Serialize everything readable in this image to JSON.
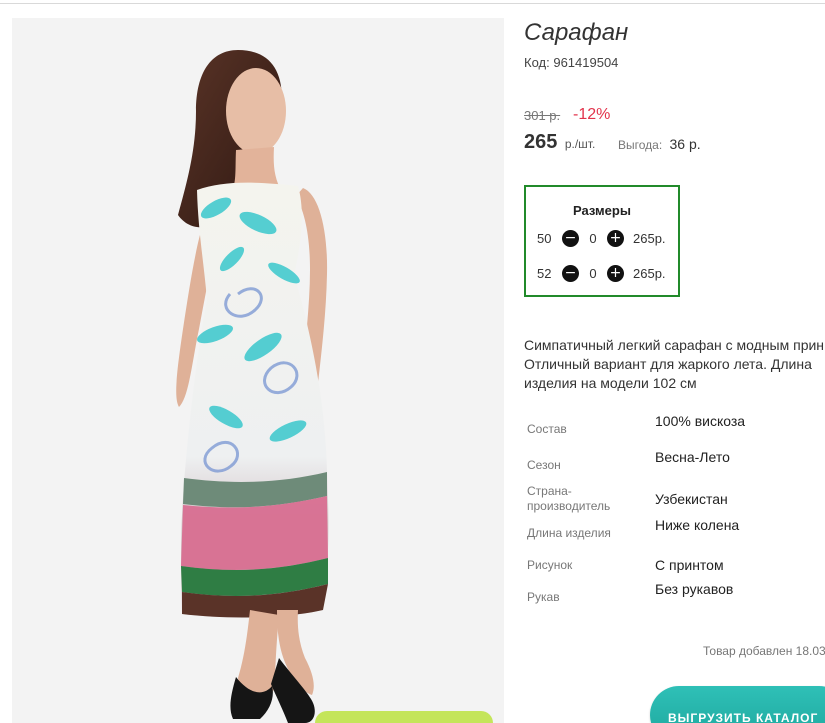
{
  "product": {
    "title": "Сарафан",
    "code_label": "Код:",
    "code_value": "961419504",
    "old_price": "301 р.",
    "discount": "-12%",
    "price_value": "265",
    "price_unit": "р./шт.",
    "benefit_label": "Выгода:",
    "benefit_value": "36 р."
  },
  "sizes": {
    "title": "Размеры",
    "items": [
      {
        "size": "50",
        "qty": "0",
        "price": "265р."
      },
      {
        "size": "52",
        "qty": "0",
        "price": "265р."
      }
    ]
  },
  "description": [
    "Симпатичный легкий сарафан с модным прин",
    "Отличный вариант для жаркого лета. Длина",
    "изделия на модели 102 см"
  ],
  "specs": [
    {
      "label": "Состав",
      "value": "100% вискоза"
    },
    {
      "label": "Сезон",
      "value": "Весна-Лето"
    },
    {
      "label": "Страна-производитель",
      "value": "Узбекистан"
    },
    {
      "label": "Длина изделия",
      "value": "Ниже колена"
    },
    {
      "label": "Рисунок",
      "value": "С принтом"
    },
    {
      "label": "Рукав",
      "value": "Без рукавов"
    }
  ],
  "footer": {
    "added_note": "Товар добавлен 18.03",
    "catalog_button": "ВЫГРУЗИТЬ КАТАЛОГ"
  },
  "icons": {
    "minus": "minus-circle-icon",
    "plus": "plus-circle-icon"
  },
  "colors": {
    "discount": "#e2334b",
    "sizes_border": "#218a2a",
    "catalog_button": "#1da79d",
    "green_button": "#c4e55a"
  }
}
